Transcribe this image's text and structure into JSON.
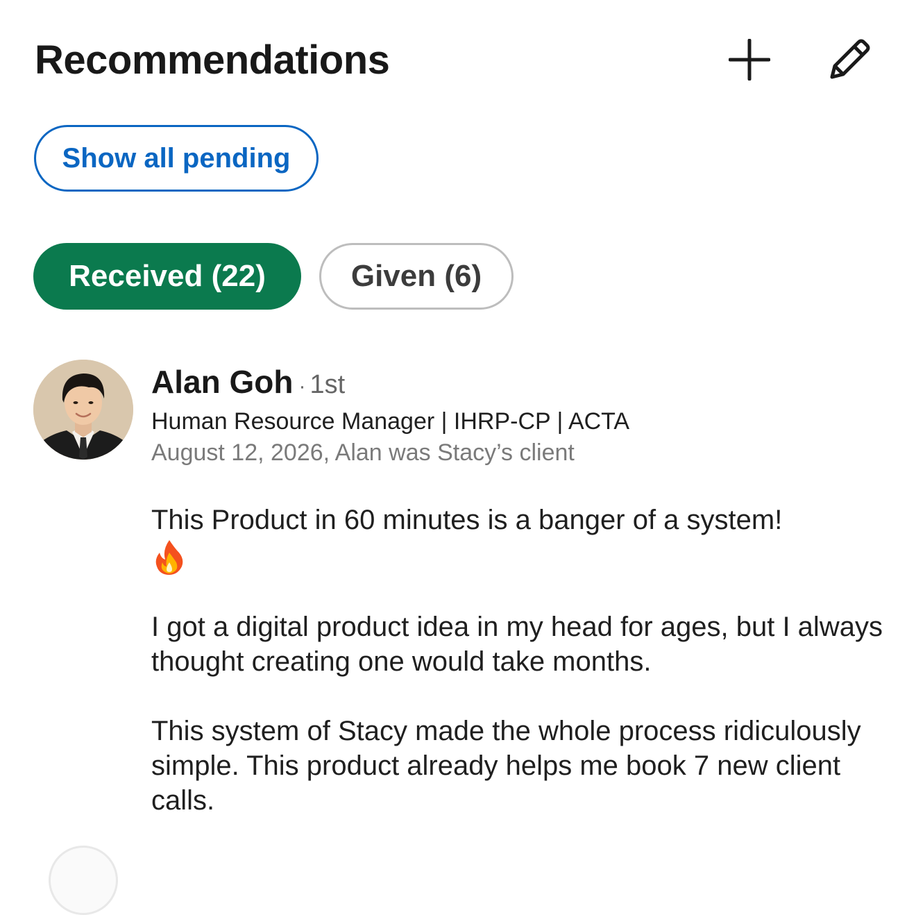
{
  "header": {
    "title": "Recommendations",
    "add_icon": "plus-icon",
    "edit_icon": "pencil-icon"
  },
  "pending_button": {
    "label": "Show all pending"
  },
  "tabs": [
    {
      "label": "Received (22)",
      "active": true
    },
    {
      "label": "Given (6)",
      "active": false
    }
  ],
  "recommendation": {
    "name": "Alan Goh",
    "separator": "·",
    "degree": "1st",
    "headline": "Human Resource Manager | IHRP-CP | ACTA",
    "meta": "August 12, 2026, Alan was Stacy’s client",
    "paragraphs": [
      "This Product in 60 minutes is a banger of a system!",
      "I got a digital product idea in my head for ages, but I always thought creating one would take months.",
      "This system of Stacy made the whole process ridiculously simple. This product already helps me book 7 new client calls."
    ],
    "emoji": "fire-emoji"
  },
  "colors": {
    "accent_blue": "#0a66c2",
    "active_tab_green": "#0b7a4e",
    "muted_text": "#7a7a7a"
  }
}
